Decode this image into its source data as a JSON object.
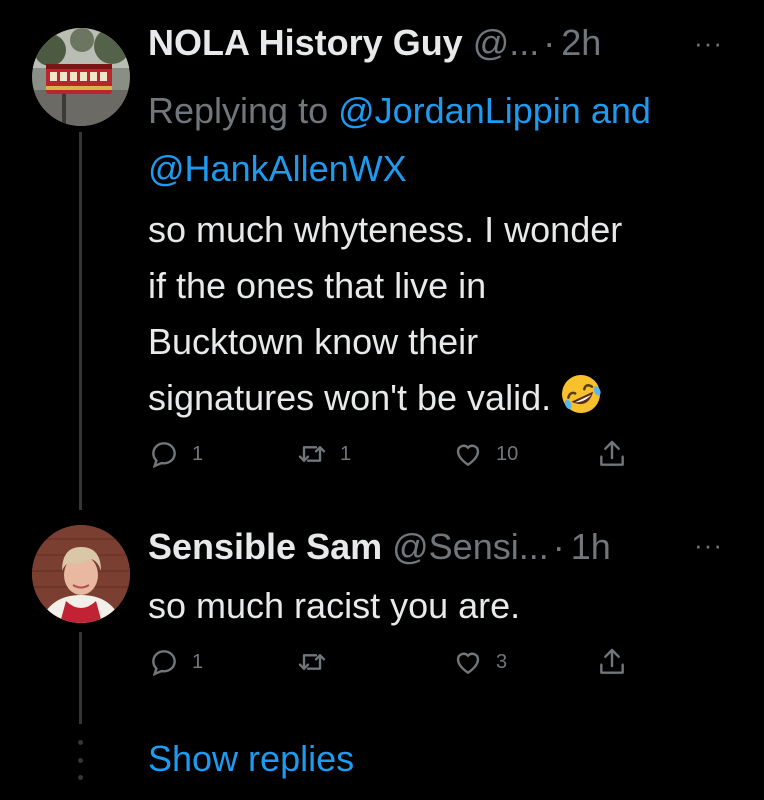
{
  "tweets": [
    {
      "name": "NOLA History Guy",
      "handle": "@...",
      "dot": "·",
      "time": "2h",
      "more": "···",
      "replying_prefix": "Replying to ",
      "mention_1": "@JordanLippin",
      "and_word": " and",
      "mention_2": "@HankAllenWX",
      "lines": [
        "so much whyteness. I wonder",
        "if the ones that live in",
        "Bucktown know their",
        "signatures won't be valid."
      ],
      "emoji_icon": "rolling-on-the-floor-laughing-emoji",
      "reply_count": "1",
      "retweet_count": "1",
      "like_count": "10"
    },
    {
      "name": "Sensible Sam",
      "handle": "@Sensi...",
      "dot": "·",
      "time": "1h",
      "more": "···",
      "lines": [
        "so much racist you are."
      ],
      "reply_count": "1",
      "retweet_count": "",
      "like_count": "3"
    }
  ],
  "show_replies": "Show replies",
  "colors": {
    "background": "#000000",
    "text": "#e7e9ea",
    "muted": "#71767b",
    "link": "#1d9bf0",
    "thread_line": "#333639"
  }
}
